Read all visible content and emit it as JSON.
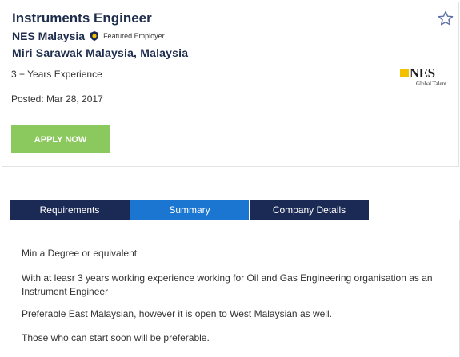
{
  "job": {
    "title": "Instruments Engineer",
    "employer": "NES Malaysia",
    "featured_label": "Featured Employer",
    "location": "Miri Sarawak Malaysia, Malaysia",
    "experience": "3 + Years Experience",
    "posted": "Posted: Mar 28, 2017",
    "apply_label": "APPLY NOW",
    "logo": {
      "name": "NES",
      "tagline": "Global Talent"
    }
  },
  "tabs": [
    {
      "label": "Requirements",
      "active": false
    },
    {
      "label": "Summary",
      "active": true
    },
    {
      "label": "Company Details",
      "active": false
    }
  ],
  "requirements": [
    "Min a Degree or equivalent",
    "With at leasr 3 years working experience working for Oil and Gas Engineering organisation as an Instrument Engineer",
    "Preferable East Malaysian, however it is open to West Malaysian as well.",
    "Those who can start soon will be preferable."
  ],
  "icons": {
    "favorite": "star-outline-icon",
    "featured": "shield-badge-icon"
  },
  "colors": {
    "title": "#1f2d4d",
    "apply_button": "#8bc95e",
    "tab": "#1b2a55",
    "tab_active": "#1b76d1",
    "star": "#5b6fa6",
    "logo_accent": "#f2c200"
  }
}
